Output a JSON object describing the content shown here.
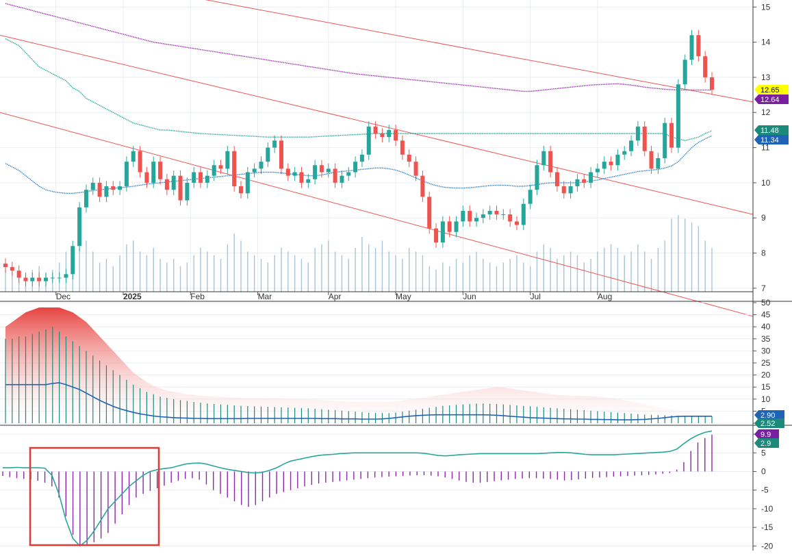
{
  "colors": {
    "up": "#26a69a",
    "down": "#ef5350",
    "volume": "#a9c4d4",
    "trendline": "#ef5350",
    "ma_purple": "#9c27b0",
    "ma_teal": "#26a69a",
    "ma_blue": "#2f80c8",
    "grid": "#e9edf2",
    "axis": "#555555",
    "highlight": "#e53935"
  },
  "chart_data": [
    {
      "type": "candlestick",
      "panel": "price",
      "y_range": [
        6.9,
        15.2
      ],
      "y_ticks": [
        "15",
        "14",
        "13",
        "12",
        "11",
        "10",
        "9",
        "8",
        "7"
      ],
      "x_labels": [
        "Dec",
        "2025",
        "Feb",
        "Mar",
        "Apr",
        "May",
        "Jun",
        "Jul",
        "Aug"
      ],
      "grid": true,
      "price_badges": [
        {
          "text": "12.65",
          "bg": "#ffff00",
          "fg": "#000000"
        },
        {
          "text": "12.64",
          "bg": "#7b1fa2",
          "fg": "#ffffff"
        },
        {
          "text": "11.48",
          "bg": "#1b8a7a",
          "fg": "#ffffff"
        },
        {
          "text": "11.34",
          "bg": "#1e63b5",
          "fg": "#ffffff"
        }
      ],
      "close_series": [
        7.6,
        7.5,
        7.3,
        7.2,
        7.3,
        7.2,
        7.3,
        7.3,
        7.3,
        7.4,
        8.2,
        9.3,
        9.8,
        10.0,
        9.6,
        9.9,
        9.8,
        9.9,
        10.6,
        10.9,
        10.3,
        10.0,
        10.6,
        10.1,
        9.8,
        10.2,
        9.5,
        10.0,
        10.3,
        10.0,
        10.2,
        10.5,
        10.4,
        10.9,
        9.9,
        9.7,
        10.3,
        10.4,
        10.6,
        11.0,
        11.2,
        10.4,
        10.2,
        10.3,
        10.0,
        10.1,
        10.5,
        10.3,
        10.4,
        10.0,
        10.2,
        10.3,
        10.6,
        10.8,
        11.6,
        11.4,
        11.3,
        11.5,
        11.2,
        10.8,
        10.6,
        10.2,
        9.6,
        8.7,
        8.3,
        8.9,
        8.6,
        8.9,
        9.2,
        8.9,
        9.0,
        9.1,
        9.2,
        9.1,
        9.1,
        8.9,
        8.8,
        9.4,
        9.8,
        10.5,
        10.9,
        10.3,
        9.9,
        9.7,
        9.9,
        10.1,
        10.0,
        10.3,
        10.4,
        10.6,
        10.5,
        10.8,
        10.9,
        11.2,
        11.6,
        10.9,
        10.4,
        10.7,
        11.7,
        11.0,
        12.8,
        13.5,
        14.2,
        13.6,
        13.0,
        12.65
      ],
      "volume_ylim": [
        0,
        30
      ],
      "volume_bars": [
        6,
        7,
        4,
        5,
        6,
        7,
        5,
        6,
        8,
        11,
        9,
        12,
        14,
        11,
        8,
        9,
        7,
        10,
        13,
        14,
        11,
        10,
        12,
        9,
        8,
        9,
        7,
        8,
        10,
        12,
        11,
        10,
        9,
        13,
        16,
        14,
        11,
        10,
        9,
        8,
        10,
        12,
        11,
        10,
        9,
        8,
        12,
        13,
        14,
        11,
        10,
        9,
        12,
        15,
        13,
        12,
        14,
        11,
        10,
        9,
        12,
        11,
        10,
        7,
        6,
        8,
        7,
        9,
        8,
        10,
        11,
        9,
        8,
        7,
        8,
        9,
        10,
        8,
        7,
        11,
        13,
        12,
        9,
        10,
        11,
        10,
        8,
        9,
        11,
        12,
        13,
        12,
        10,
        11,
        13,
        11,
        9,
        12,
        14,
        20,
        21,
        20,
        19,
        18,
        14,
        12
      ],
      "series": [
        {
          "name": "",
          "values": [
            14.1,
            14.0,
            13.9,
            13.7,
            13.5,
            13.3,
            13.2,
            13.1,
            13.0,
            12.9,
            12.7,
            12.6,
            12.4,
            12.3,
            12.2,
            12.1,
            12.0,
            11.9,
            11.8,
            11.7,
            11.65,
            11.6,
            11.55,
            11.5,
            11.5,
            11.48,
            11.46,
            11.44,
            11.42,
            11.4,
            11.39,
            11.38,
            11.37,
            11.36,
            11.35,
            11.34,
            11.33,
            11.32,
            11.31,
            11.3,
            11.3,
            11.3,
            11.3,
            11.3,
            11.3,
            11.3,
            11.31,
            11.32,
            11.33,
            11.34,
            11.35,
            11.36,
            11.37,
            11.38,
            11.39,
            11.4,
            11.4,
            11.4,
            11.4,
            11.4,
            11.4,
            11.4,
            11.4,
            11.4,
            11.4,
            11.4,
            11.4,
            11.4,
            11.4,
            11.4,
            11.4,
            11.4,
            11.4,
            11.4,
            11.4,
            11.4,
            11.4,
            11.4,
            11.4,
            11.4,
            11.4,
            11.4,
            11.4,
            11.4,
            11.4,
            11.4,
            11.4,
            11.4,
            11.4,
            11.4,
            11.4,
            11.4,
            11.4,
            11.4,
            11.4,
            11.4,
            11.4,
            11.4,
            11.4,
            11.3,
            11.25,
            11.2,
            11.25,
            11.3,
            11.4,
            11.48
          ]
        },
        {
          "name": "",
          "values": [
            15.1,
            15.05,
            15.0,
            14.95,
            14.9,
            14.85,
            14.8,
            14.75,
            14.7,
            14.65,
            14.6,
            14.55,
            14.5,
            14.45,
            14.4,
            14.35,
            14.3,
            14.25,
            14.2,
            14.15,
            14.1,
            14.05,
            14.0,
            13.97,
            13.94,
            13.91,
            13.88,
            13.85,
            13.82,
            13.79,
            13.76,
            13.73,
            13.7,
            13.67,
            13.64,
            13.61,
            13.58,
            13.55,
            13.52,
            13.49,
            13.46,
            13.43,
            13.4,
            13.37,
            13.34,
            13.31,
            13.28,
            13.25,
            13.22,
            13.19,
            13.16,
            13.13,
            13.1,
            13.08,
            13.06,
            13.04,
            13.02,
            13.0,
            12.98,
            12.96,
            12.94,
            12.92,
            12.9,
            12.88,
            12.86,
            12.84,
            12.82,
            12.8,
            12.78,
            12.76,
            12.74,
            12.72,
            12.7,
            12.68,
            12.66,
            12.64,
            12.62,
            12.6,
            12.6,
            12.62,
            12.64,
            12.66,
            12.68,
            12.7,
            12.72,
            12.74,
            12.76,
            12.78,
            12.79,
            12.8,
            12.81,
            12.82,
            12.8,
            12.78,
            12.75,
            12.72,
            12.7,
            12.68,
            12.66,
            12.65,
            12.64,
            12.64,
            12.64,
            12.64,
            12.64,
            12.64
          ]
        },
        {
          "name": "",
          "values": [
            10.55,
            10.45,
            10.35,
            10.2,
            10.05,
            9.9,
            9.8,
            9.75,
            9.72,
            9.7,
            9.7,
            9.72,
            9.75,
            9.78,
            9.8,
            9.82,
            9.84,
            9.86,
            9.88,
            9.9,
            9.93,
            9.96,
            9.98,
            10.0,
            10.02,
            10.04,
            10.06,
            10.08,
            10.1,
            10.12,
            10.14,
            10.16,
            10.18,
            10.2,
            10.22,
            10.24,
            10.26,
            10.28,
            10.3,
            10.3,
            10.3,
            10.28,
            10.26,
            10.24,
            10.22,
            10.2,
            10.2,
            10.22,
            10.26,
            10.3,
            10.32,
            10.34,
            10.36,
            10.38,
            10.4,
            10.42,
            10.42,
            10.4,
            10.36,
            10.3,
            10.22,
            10.14,
            10.05,
            9.98,
            9.92,
            9.88,
            9.86,
            9.85,
            9.85,
            9.86,
            9.88,
            9.9,
            9.92,
            9.93,
            9.93,
            9.92,
            9.9,
            9.9,
            9.92,
            9.95,
            9.98,
            10.0,
            10.0,
            10.0,
            10.0,
            10.0,
            10.02,
            10.05,
            10.08,
            10.12,
            10.16,
            10.2,
            10.24,
            10.28,
            10.32,
            10.34,
            10.36,
            10.38,
            10.42,
            10.48,
            10.6,
            10.8,
            11.0,
            11.15,
            11.25,
            11.34
          ]
        }
      ],
      "trendlines": [
        [
          0,
          14.2,
          1100,
          9.1
        ],
        [
          0,
          16.3,
          1100,
          12.3
        ],
        [
          0,
          12.0,
          1100,
          6.2
        ]
      ]
    },
    {
      "type": "area",
      "panel": "indicator-1",
      "y_range": [
        0,
        50
      ],
      "y_ticks": [
        "50",
        "45",
        "40",
        "35",
        "30",
        "25",
        "20",
        "15",
        "10",
        "5",
        "0"
      ],
      "price_badges": [
        {
          "text": "2.90",
          "bg": "#1e63b5",
          "fg": "#ffffff"
        },
        {
          "text": "2.52",
          "bg": "#1b8a7a",
          "fg": "#ffffff"
        }
      ],
      "area_values": [
        40,
        42,
        44,
        46,
        47,
        48,
        48,
        48,
        48,
        47,
        46,
        44,
        42,
        39,
        36,
        33,
        30,
        27,
        24,
        21,
        19,
        17,
        15.5,
        14.5,
        13.5,
        13,
        12.5,
        12,
        11.7,
        11.4,
        11.2,
        11.0,
        10.9,
        10.8,
        10.7,
        10.6,
        10.5,
        10.4,
        10.4,
        10.3,
        10.3,
        10.2,
        10.1,
        10.1,
        10.0,
        10.0,
        9.8,
        9.6,
        9.4,
        9.2,
        9.1,
        9.0,
        8.9,
        8.8,
        8.8,
        8.8,
        8.8,
        8.9,
        9.1,
        9.4,
        9.8,
        10.2,
        10.6,
        11.0,
        11.4,
        11.8,
        12.2,
        12.6,
        13.0,
        13.4,
        13.8,
        14.2,
        14.6,
        15.0,
        14.8,
        14.4,
        14.0,
        13.6,
        13.2,
        12.8,
        12.4,
        12.0,
        11.8,
        11.6,
        11.5,
        11.4,
        11.3,
        11.2,
        11.0,
        10.8,
        10.5,
        10.1,
        9.6,
        9.0,
        8.4,
        7.8,
        7.2,
        6.6,
        6.1,
        5.6,
        5.2,
        4.9,
        4.6,
        4.4,
        4.2
      ],
      "bar_values": [
        35,
        35,
        36,
        36,
        37,
        38,
        39,
        40,
        38,
        36,
        34,
        32,
        30,
        28,
        26,
        24,
        22,
        20,
        18,
        16,
        14.5,
        13,
        12,
        11,
        10.5,
        10,
        9.6,
        9.2,
        8.8,
        8.5,
        8.2,
        8.0,
        7.8,
        7.6,
        7.4,
        7.2,
        7.1,
        7.0,
        6.9,
        6.8,
        6.7,
        6.6,
        6.5,
        6.4,
        6.3,
        6.2,
        6.0,
        5.8,
        5.6,
        5.4,
        5.2,
        5.0,
        4.8,
        4.6,
        4.4,
        4.3,
        4.2,
        4.2,
        4.4,
        4.8,
        5.2,
        5.6,
        6.0,
        6.4,
        6.8,
        7.2,
        7.4,
        7.6,
        7.8,
        8.0,
        8.1,
        8.2,
        8.1,
        8.0,
        7.8,
        7.6,
        7.4,
        7.2,
        7.0,
        6.8,
        6.6,
        6.4,
        6.2,
        6.0,
        5.8,
        5.6,
        5.4,
        5.2,
        5.0,
        4.8,
        4.6,
        4.4,
        4.2,
        4.0,
        3.8,
        3.6,
        3.5,
        3.4,
        3.3,
        3.2,
        3.1,
        3.0,
        3.0,
        2.9,
        2.9,
        2.9
      ],
      "line_values": [
        16,
        16,
        16,
        16,
        16,
        16,
        16,
        16.5,
        16.8,
        16,
        15,
        14,
        12.5,
        11,
        9.5,
        8.2,
        7,
        6,
        5.2,
        4.5,
        3.9,
        3.4,
        3.0,
        2.7,
        2.5,
        2.3,
        2.2,
        2.1,
        2.0,
        2.0,
        1.9,
        1.9,
        1.9,
        1.9,
        1.9,
        1.9,
        2.0,
        2.0,
        2.0,
        2.0,
        2.0,
        2.0,
        2.0,
        2.0,
        2.0,
        2.0,
        2.0,
        1.9,
        1.9,
        1.9,
        1.8,
        1.8,
        1.8,
        1.7,
        1.7,
        1.7,
        1.8,
        2.0,
        2.3,
        2.6,
        2.9,
        3.1,
        3.3,
        3.4,
        3.5,
        3.5,
        3.5,
        3.5,
        3.5,
        3.5,
        3.5,
        3.5,
        3.4,
        3.3,
        3.1,
        2.9,
        2.7,
        2.5,
        2.3,
        2.2,
        2.1,
        2.0,
        1.9,
        1.8,
        1.8,
        1.7,
        1.7,
        1.6,
        1.6,
        1.5,
        1.5,
        1.4,
        1.4,
        1.4,
        1.5,
        1.6,
        1.8,
        2.0,
        2.3,
        2.6,
        2.8,
        2.9,
        2.9,
        2.9,
        2.9,
        2.9
      ]
    },
    {
      "type": "bar",
      "panel": "indicator-2",
      "y_range": [
        -20.5,
        11.5
      ],
      "y_ticks": [
        "10",
        "5",
        "0",
        "-5",
        "-10",
        "-15",
        "-20"
      ],
      "price_badges": [
        {
          "text": "9.9",
          "bg": "#7b1fa2",
          "fg": "#ffffff"
        },
        {
          "text": "2.9",
          "bg": "#1b8a7a",
          "fg": "#ffffff"
        }
      ],
      "bar_values": [
        -1.2,
        -1.5,
        -1.8,
        -2.0,
        -2.2,
        -2.5,
        -3.0,
        -4.0,
        -7.0,
        -12.0,
        -17.0,
        -20.0,
        -19.5,
        -19.0,
        -18.0,
        -16.5,
        -14.0,
        -11.5,
        -9.0,
        -7.0,
        -6.0,
        -5.2,
        -4.5,
        -3.8,
        -3.0,
        -2.5,
        -2.0,
        -1.8,
        -2.2,
        -3.5,
        -5.0,
        -6.0,
        -7.0,
        -8.0,
        -9.0,
        -9.5,
        -9.0,
        -8.0,
        -7.0,
        -6.0,
        -5.5,
        -5.0,
        -4.5,
        -4.0,
        -3.6,
        -3.2,
        -3.0,
        -2.8,
        -2.6,
        -2.4,
        -2.2,
        -2.0,
        -1.8,
        -1.6,
        -1.5,
        -1.4,
        -1.3,
        -1.2,
        -1.1,
        -1.0,
        -1.0,
        -1.1,
        -1.3,
        -1.6,
        -2.0,
        -2.4,
        -2.8,
        -3.0,
        -3.0,
        -2.8,
        -2.6,
        -2.4,
        -2.2,
        -2.0,
        -1.9,
        -1.8,
        -1.8,
        -1.9,
        -2.0,
        -2.2,
        -2.4,
        -2.3,
        -2.1,
        -1.9,
        -1.7,
        -1.6,
        -1.5,
        -1.4,
        -1.3,
        -1.2,
        -1.1,
        -1.0,
        -0.9,
        -0.8,
        -0.6,
        -0.4,
        0.5,
        2.5,
        5.5,
        7.8,
        9.0,
        9.9
      ],
      "line_values": [
        1.0,
        1.0,
        1.1,
        1.0,
        1.0,
        1.0,
        0.9,
        -1.0,
        -6.0,
        -13.0,
        -18.0,
        -20.0,
        -18.5,
        -16.0,
        -13.0,
        -10.0,
        -8.0,
        -6.0,
        -4.0,
        -2.5,
        -1.0,
        0.0,
        0.5,
        0.8,
        1.0,
        1.5,
        2.0,
        2.2,
        2.3,
        2.0,
        1.5,
        1.0,
        0.6,
        0.3,
        0.0,
        -0.3,
        -0.4,
        -0.2,
        0.3,
        1.0,
        2.0,
        2.8,
        3.2,
        3.6,
        4.0,
        4.3,
        4.5,
        4.6,
        4.8,
        4.9,
        5.0,
        5.0,
        5.0,
        5.0,
        5.0,
        5.0,
        5.0,
        5.0,
        5.0,
        5.0,
        4.9,
        4.6,
        4.3,
        4.2,
        4.3,
        4.5,
        4.6,
        4.7,
        4.8,
        4.8,
        4.8,
        4.8,
        4.8,
        4.8,
        4.8,
        4.8,
        4.8,
        4.9,
        5.0,
        5.1,
        5.1,
        5.0,
        4.8,
        4.6,
        4.5,
        4.5,
        4.5,
        4.5,
        4.6,
        4.7,
        4.8,
        4.9,
        5.0,
        5.1,
        5.2,
        5.4,
        6.0,
        7.5,
        8.8,
        9.8,
        10.5,
        10.9
      ],
      "highlight_box": true
    }
  ]
}
